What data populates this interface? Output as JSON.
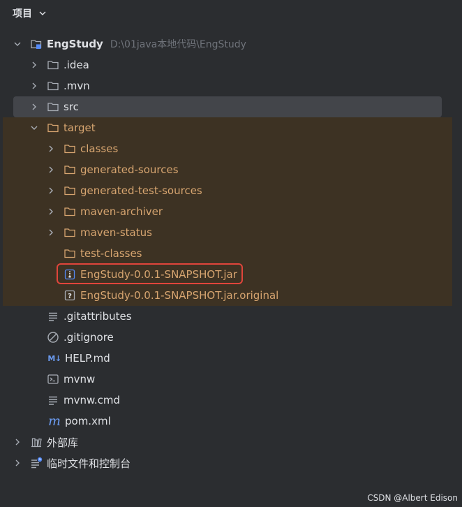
{
  "header": {
    "title": "项目"
  },
  "tree": {
    "root": {
      "label": "EngStudy",
      "path": "D:\\01java本地代码\\EngStudy"
    },
    "idea": {
      "label": ".idea"
    },
    "mvn": {
      "label": ".mvn"
    },
    "src": {
      "label": "src"
    },
    "target": {
      "label": "target"
    },
    "classes": {
      "label": "classes"
    },
    "generated_sources": {
      "label": "generated-sources"
    },
    "generated_test_sources": {
      "label": "generated-test-sources"
    },
    "maven_archiver": {
      "label": "maven-archiver"
    },
    "maven_status": {
      "label": "maven-status"
    },
    "test_classes": {
      "label": "test-classes"
    },
    "jar": {
      "label": "EngStudy-0.0.1-SNAPSHOT.jar"
    },
    "jar_original": {
      "label": "EngStudy-0.0.1-SNAPSHOT.jar.original"
    },
    "gitattributes": {
      "label": ".gitattributes"
    },
    "gitignore": {
      "label": ".gitignore"
    },
    "help": {
      "label": "HELP.md",
      "badge": "M↓"
    },
    "mvnw": {
      "label": "mvnw"
    },
    "mvnw_cmd": {
      "label": "mvnw.cmd"
    },
    "pom": {
      "label": "pom.xml",
      "badge": "m"
    },
    "external_libs": {
      "label": "外部库"
    },
    "scratches": {
      "label": "临时文件和控制台"
    }
  },
  "watermark": "CSDN @Albert Edison",
  "colors": {
    "background": "#2b2d30",
    "excluded": "#3d3223",
    "selected": "#43454a",
    "excluded_text": "#d7a570",
    "highlight_border": "#e0453b"
  }
}
